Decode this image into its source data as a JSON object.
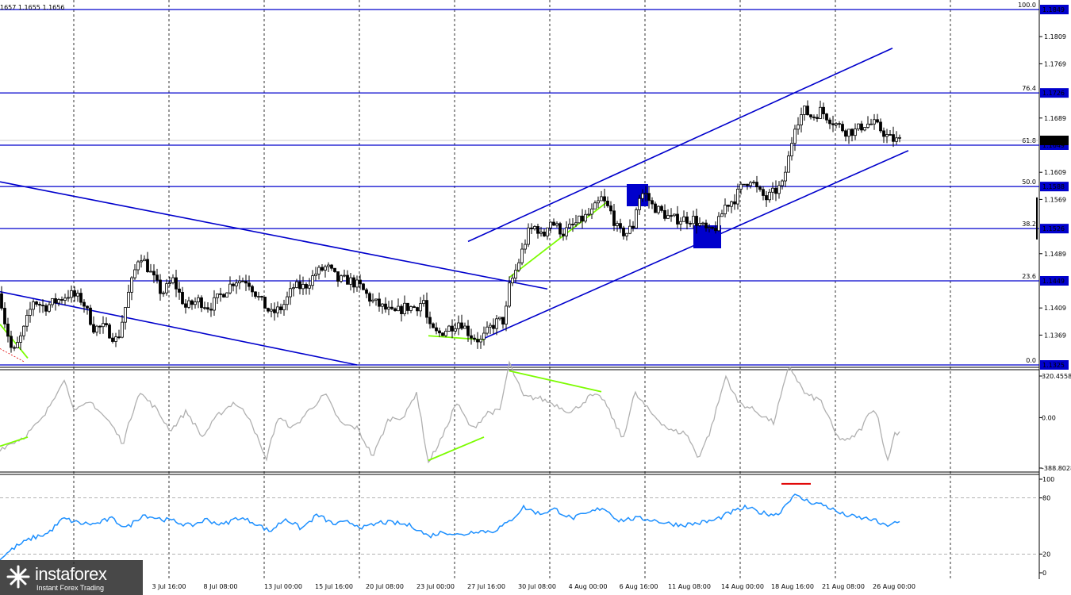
{
  "header": {
    "ohlc_text": "1657 1.1655 1.1656"
  },
  "logo": {
    "name": "instaforex",
    "tagline": "Instant Forex Trading",
    "icon": "instaforex-star-logo"
  },
  "colors": {
    "candle": "#000000",
    "blue": "#0000cc",
    "green": "#7cfc00",
    "cci": "#b0b0b0",
    "rsi": "#1e90ff",
    "red": "#e00000",
    "grid": "#000000"
  },
  "chart_data": [
    {
      "type": "candlestick",
      "panel": "price",
      "ylim": [
        1.1325,
        1.1849
      ],
      "price_ticks": [
        "1.1809",
        "1.1769",
        "1.1689",
        "1.1609",
        "1.1569",
        "1.1489",
        "1.1409",
        "1.1369"
      ],
      "current_price": "1.1656",
      "fib_levels": [
        {
          "pct": "100.0",
          "price": "1.1849",
          "value": 1.1849
        },
        {
          "pct": "76.4",
          "price": "1.1726",
          "value": 1.1726
        },
        {
          "pct": "61.8",
          "price": "1.1649",
          "value": 1.1649
        },
        {
          "pct": "50.0",
          "price": "1.1588",
          "value": 1.1588
        },
        {
          "pct": "38.2",
          "price": "1.1526",
          "value": 1.1526
        },
        {
          "pct": "23.6",
          "price": "1.1449",
          "value": 1.1449
        },
        {
          "pct": "0.0",
          "price": "1.1325",
          "value": 1.1325
        }
      ],
      "x_labels": [
        "3 Jul 16:00",
        "8 Jul 08:00",
        "13 Jul 00:00",
        "15 Jul 16:00",
        "20 Jul 08:00",
        "23 Jul 00:00",
        "27 Jul 16:00",
        "30 Jul 08:00",
        "4 Aug 00:00",
        "6 Aug 16:00",
        "11 Aug 08:00",
        "14 Aug 00:00",
        "18 Aug 16:00",
        "21 Aug 08:00",
        "26 Aug 00:00"
      ],
      "close_anchors": [
        [
          0,
          1.143
        ],
        [
          6,
          1.139
        ],
        [
          16,
          1.134
        ],
        [
          28,
          1.137
        ],
        [
          42,
          1.142
        ],
        [
          56,
          1.141
        ],
        [
          72,
          1.142
        ],
        [
          88,
          1.143
        ],
        [
          104,
          1.142
        ],
        [
          118,
          1.138
        ],
        [
          132,
          1.138
        ],
        [
          148,
          1.136
        ],
        [
          162,
          1.143
        ],
        [
          176,
          1.149
        ],
        [
          190,
          1.146
        ],
        [
          204,
          1.143
        ],
        [
          218,
          1.145
        ],
        [
          234,
          1.141
        ],
        [
          250,
          1.142
        ],
        [
          264,
          1.141
        ],
        [
          280,
          1.143
        ],
        [
          296,
          1.145
        ],
        [
          312,
          1.145
        ],
        [
          328,
          1.142
        ],
        [
          342,
          1.14
        ],
        [
          356,
          1.141
        ],
        [
          370,
          1.144
        ],
        [
          384,
          1.144
        ],
        [
          398,
          1.146
        ],
        [
          412,
          1.147
        ],
        [
          426,
          1.145
        ],
        [
          440,
          1.145
        ],
        [
          454,
          1.144
        ],
        [
          468,
          1.142
        ],
        [
          482,
          1.141
        ],
        [
          496,
          1.14
        ],
        [
          510,
          1.141
        ],
        [
          524,
          1.141
        ],
        [
          534,
          1.142
        ],
        [
          540,
          1.138
        ],
        [
          552,
          1.137
        ],
        [
          566,
          1.138
        ],
        [
          580,
          1.139
        ],
        [
          592,
          1.137
        ],
        [
          606,
          1.136
        ],
        [
          618,
          1.138
        ],
        [
          628,
          1.139
        ],
        [
          636,
          1.139
        ],
        [
          642,
          1.144
        ],
        [
          652,
          1.147
        ],
        [
          660,
          1.15
        ],
        [
          666,
          1.152
        ],
        [
          676,
          1.153
        ],
        [
          684,
          1.151
        ],
        [
          692,
          1.154
        ],
        [
          700,
          1.153
        ],
        [
          710,
          1.152
        ],
        [
          722,
          1.153
        ],
        [
          734,
          1.154
        ],
        [
          746,
          1.155
        ],
        [
          758,
          1.157
        ],
        [
          770,
          1.155
        ],
        [
          780,
          1.152
        ],
        [
          790,
          1.152
        ],
        [
          798,
          1.153
        ],
        [
          804,
          1.157
        ],
        [
          812,
          1.158
        ],
        [
          822,
          1.156
        ],
        [
          834,
          1.155
        ],
        [
          846,
          1.154
        ],
        [
          860,
          1.154
        ],
        [
          874,
          1.154
        ],
        [
          884,
          1.153
        ],
        [
          894,
          1.152
        ],
        [
          904,
          1.153
        ],
        [
          914,
          1.156
        ],
        [
          926,
          1.157
        ],
        [
          936,
          1.159
        ],
        [
          946,
          1.16
        ],
        [
          956,
          1.158
        ],
        [
          966,
          1.157
        ],
        [
          976,
          1.158
        ],
        [
          986,
          1.159
        ],
        [
          994,
          1.163
        ],
        [
          1002,
          1.168
        ],
        [
          1014,
          1.17
        ],
        [
          1024,
          1.169
        ],
        [
          1034,
          1.17
        ],
        [
          1044,
          1.169
        ],
        [
          1054,
          1.168
        ],
        [
          1066,
          1.167
        ],
        [
          1078,
          1.167
        ],
        [
          1090,
          1.168
        ],
        [
          1102,
          1.168
        ],
        [
          1112,
          1.167
        ],
        [
          1120,
          1.166
        ],
        [
          1128,
          1.1656
        ],
        [
          1134,
          1.1656
        ]
      ]
    },
    {
      "type": "line",
      "panel": "cci",
      "ylim": [
        -388.8028,
        320.4558
      ],
      "ticks": [
        "320.4558",
        "0.00",
        "-388.8028"
      ],
      "values_anchors": [
        [
          0,
          -240
        ],
        [
          30,
          -150
        ],
        [
          55,
          0
        ],
        [
          80,
          300
        ],
        [
          95,
          50
        ],
        [
          115,
          120
        ],
        [
          140,
          -50
        ],
        [
          155,
          -200
        ],
        [
          175,
          200
        ],
        [
          195,
          80
        ],
        [
          215,
          -100
        ],
        [
          235,
          50
        ],
        [
          255,
          -150
        ],
        [
          275,
          20
        ],
        [
          295,
          120
        ],
        [
          315,
          0
        ],
        [
          335,
          -330
        ],
        [
          350,
          0
        ],
        [
          370,
          -80
        ],
        [
          390,
          60
        ],
        [
          410,
          180
        ],
        [
          430,
          -50
        ],
        [
          450,
          -80
        ],
        [
          470,
          -300
        ],
        [
          490,
          -10
        ],
        [
          510,
          10
        ],
        [
          525,
          200
        ],
        [
          540,
          -350
        ],
        [
          560,
          -120
        ],
        [
          575,
          120
        ],
        [
          595,
          -90
        ],
        [
          615,
          40
        ],
        [
          630,
          50
        ],
        [
          642,
          420
        ],
        [
          660,
          160
        ],
        [
          680,
          150
        ],
        [
          700,
          100
        ],
        [
          720,
          40
        ],
        [
          745,
          170
        ],
        [
          760,
          150
        ],
        [
          785,
          -170
        ],
        [
          800,
          190
        ],
        [
          820,
          40
        ],
        [
          845,
          -100
        ],
        [
          865,
          -120
        ],
        [
          880,
          -310
        ],
        [
          895,
          -110
        ],
        [
          915,
          320
        ],
        [
          930,
          120
        ],
        [
          950,
          60
        ],
        [
          975,
          -40
        ],
        [
          995,
          400
        ],
        [
          1015,
          180
        ],
        [
          1035,
          130
        ],
        [
          1055,
          -150
        ],
        [
          1070,
          -180
        ],
        [
          1085,
          -90
        ],
        [
          1100,
          80
        ],
        [
          1108,
          -20
        ],
        [
          1118,
          -350
        ],
        [
          1128,
          -120
        ],
        [
          1134,
          -110
        ]
      ]
    },
    {
      "type": "line",
      "panel": "rsi",
      "ylim": [
        0,
        100
      ],
      "ticks": [
        "100",
        "80",
        "20",
        "0"
      ],
      "values_anchors": [
        [
          0,
          15
        ],
        [
          20,
          28
        ],
        [
          40,
          37
        ],
        [
          60,
          42
        ],
        [
          80,
          58
        ],
        [
          100,
          53
        ],
        [
          120,
          52
        ],
        [
          140,
          58
        ],
        [
          160,
          48
        ],
        [
          180,
          62
        ],
        [
          200,
          58
        ],
        [
          220,
          55
        ],
        [
          240,
          50
        ],
        [
          260,
          57
        ],
        [
          280,
          51
        ],
        [
          300,
          59
        ],
        [
          320,
          54
        ],
        [
          340,
          44
        ],
        [
          360,
          58
        ],
        [
          380,
          47
        ],
        [
          400,
          62
        ],
        [
          420,
          52
        ],
        [
          440,
          54
        ],
        [
          460,
          48
        ],
        [
          480,
          54
        ],
        [
          500,
          53
        ],
        [
          520,
          50
        ],
        [
          540,
          39
        ],
        [
          560,
          44
        ],
        [
          580,
          40
        ],
        [
          600,
          45
        ],
        [
          620,
          44
        ],
        [
          640,
          53
        ],
        [
          660,
          70
        ],
        [
          680,
          63
        ],
        [
          700,
          68
        ],
        [
          720,
          58
        ],
        [
          740,
          63
        ],
        [
          760,
          70
        ],
        [
          780,
          56
        ],
        [
          800,
          58
        ],
        [
          820,
          57
        ],
        [
          840,
          53
        ],
        [
          860,
          51
        ],
        [
          880,
          53
        ],
        [
          900,
          56
        ],
        [
          920,
          64
        ],
        [
          940,
          70
        ],
        [
          960,
          64
        ],
        [
          980,
          62
        ],
        [
          1000,
          83
        ],
        [
          1020,
          76
        ],
        [
          1040,
          72
        ],
        [
          1060,
          63
        ],
        [
          1080,
          59
        ],
        [
          1100,
          57
        ],
        [
          1115,
          50
        ],
        [
          1125,
          53
        ],
        [
          1134,
          53
        ]
      ]
    }
  ]
}
